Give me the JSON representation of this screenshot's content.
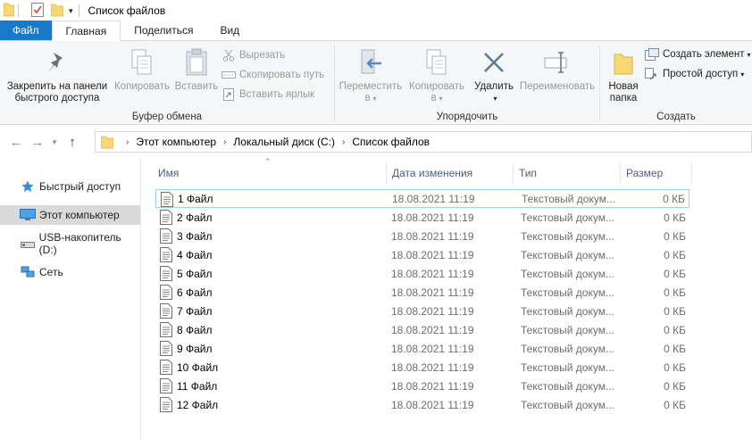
{
  "window": {
    "title": "Список файлов"
  },
  "tabs": [
    {
      "label": "Файл"
    },
    {
      "label": "Главная"
    },
    {
      "label": "Поделиться"
    },
    {
      "label": "Вид"
    }
  ],
  "ribbon": {
    "clipboard": {
      "label": "Буфер обмена",
      "pin": "Закрепить на панели быстрого доступа",
      "pin_line1": "Закрепить на панели",
      "pin_line2": "быстрого доступа",
      "copy": "Копировать",
      "paste": "Вставить",
      "cut": "Вырезать",
      "copy_path": "Скопировать путь",
      "paste_shortcut": "Вставить ярлык"
    },
    "organize": {
      "label": "Упорядочить",
      "move_line1": "Переместить",
      "move_line2": "в",
      "copy_line1": "Копировать",
      "copy_line2": "в",
      "delete": "Удалить",
      "rename": "Переименовать"
    },
    "create": {
      "label": "Создать",
      "new_folder_line1": "Новая",
      "new_folder_line2": "папка",
      "new_item": "Создать элемент",
      "easy_access": "Простой доступ"
    }
  },
  "address": {
    "crumbs": [
      "Этот компьютер",
      "Локальный диск (C:)",
      "Список файлов"
    ]
  },
  "navpane": {
    "items": [
      {
        "label": "Быстрый доступ"
      },
      {
        "label": "Этот компьютер"
      },
      {
        "label": "USB-накопитель (D:)"
      },
      {
        "label": "Сеть"
      }
    ]
  },
  "columns": {
    "name": "Имя",
    "date": "Дата изменения",
    "type": "Тип",
    "size": "Размер"
  },
  "files": [
    {
      "name": "1 Файл",
      "date": "18.08.2021 11:19",
      "type": "Текстовый докум...",
      "size": "0 КБ"
    },
    {
      "name": "2 Файл",
      "date": "18.08.2021 11:19",
      "type": "Текстовый докум...",
      "size": "0 КБ"
    },
    {
      "name": "3 Файл",
      "date": "18.08.2021 11:19",
      "type": "Текстовый докум...",
      "size": "0 КБ"
    },
    {
      "name": "4 Файл",
      "date": "18.08.2021 11:19",
      "type": "Текстовый докум...",
      "size": "0 КБ"
    },
    {
      "name": "5 Файл",
      "date": "18.08.2021 11:19",
      "type": "Текстовый докум...",
      "size": "0 КБ"
    },
    {
      "name": "6 Файл",
      "date": "18.08.2021 11:19",
      "type": "Текстовый докум...",
      "size": "0 КБ"
    },
    {
      "name": "7 Файл",
      "date": "18.08.2021 11:19",
      "type": "Текстовый докум...",
      "size": "0 КБ"
    },
    {
      "name": "8 Файл",
      "date": "18.08.2021 11:19",
      "type": "Текстовый докум...",
      "size": "0 КБ"
    },
    {
      "name": "9 Файл",
      "date": "18.08.2021 11:19",
      "type": "Текстовый докум...",
      "size": "0 КБ"
    },
    {
      "name": "10 Файл",
      "date": "18.08.2021 11:19",
      "type": "Текстовый докум...",
      "size": "0 КБ"
    },
    {
      "name": "11 Файл",
      "date": "18.08.2021 11:19",
      "type": "Текстовый докум...",
      "size": "0 КБ"
    },
    {
      "name": "12 Файл",
      "date": "18.08.2021 11:19",
      "type": "Текстовый докум...",
      "size": "0 КБ"
    }
  ],
  "colors": {
    "file_tab": "#1979ca",
    "selection_border": "#99d1ff",
    "nav_selected": "#d9d9d9"
  }
}
